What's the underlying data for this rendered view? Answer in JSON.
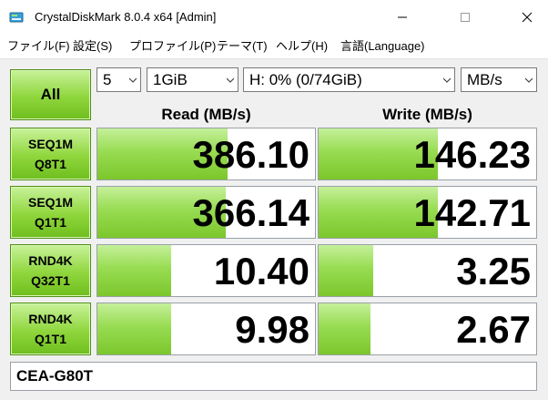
{
  "window": {
    "title": "CrystalDiskMark 8.0.4 x64 [Admin]"
  },
  "menu": {
    "file": "ファイル(F)",
    "settings": "設定(S)",
    "profile": "プロファイル(P)",
    "theme": "テーマ(T)",
    "help": "ヘルプ(H)",
    "language": "言語(Language)"
  },
  "controls": {
    "all_label": "All",
    "count": "5",
    "size": "1GiB",
    "drive": "H: 0% (0/74GiB)",
    "unit": "MB/s"
  },
  "headers": {
    "read": "Read (MB/s)",
    "write": "Write (MB/s)"
  },
  "tests": [
    {
      "line1": "SEQ1M",
      "line2": "Q8T1",
      "read": "386.10",
      "write": "146.23",
      "read_level": 0.6,
      "write_level": 0.55
    },
    {
      "line1": "SEQ1M",
      "line2": "Q1T1",
      "read": "366.14",
      "write": "142.71",
      "read_level": 0.59,
      "write_level": 0.55
    },
    {
      "line1": "RND4K",
      "line2": "Q32T1",
      "read": "10.40",
      "write": "3.25",
      "read_level": 0.34,
      "write_level": 0.25
    },
    {
      "line1": "RND4K",
      "line2": "Q1T1",
      "read": "9.98",
      "write": "2.67",
      "read_level": 0.34,
      "write_level": 0.24
    }
  ],
  "comment": "CEA-G80T",
  "colors": {
    "accent_green": "#8fd63c",
    "border_green": "#4f8f18"
  }
}
